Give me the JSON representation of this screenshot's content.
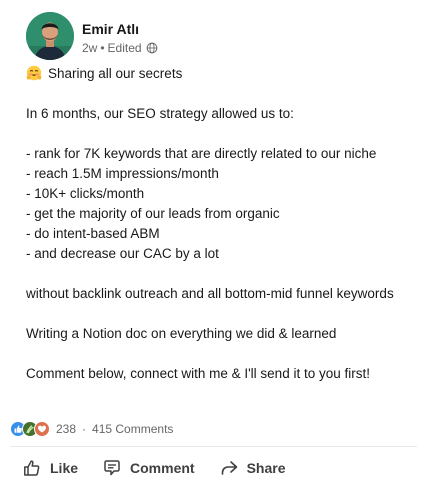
{
  "author": {
    "name": "Emir Atlı",
    "time": "2w",
    "edited": "Edited"
  },
  "post": {
    "lines": [
      "Sharing all our secrets",
      "",
      "In 6 months, our SEO strategy allowed us to:",
      "",
      "- rank for 7K keywords that are directly related to our niche",
      "- reach 1.5M impressions/month",
      "- 10K+ clicks/month",
      "- get the majority of our leads from organic",
      "- do intent-based ABM",
      "- and decrease our CAC by a lot",
      "",
      "without backlink outreach and all bottom-mid funnel keywords",
      "",
      "Writing a Notion doc on everything we did & learned",
      "",
      "Comment below, connect with me & I'll send it to you first!"
    ]
  },
  "social": {
    "reaction_count": "238",
    "comments": "415 Comments"
  },
  "actions": {
    "like": "Like",
    "comment": "Comment",
    "share": "Share"
  },
  "colors": {
    "like_blue": "#378fe9",
    "celebrate_green": "#44712e",
    "love_red": "#df704d",
    "text_primary": "#191919",
    "text_secondary": "#666666"
  },
  "icons": {
    "first_line_emoji": "hugging-face-emoji",
    "visibility": "globe-icon"
  }
}
